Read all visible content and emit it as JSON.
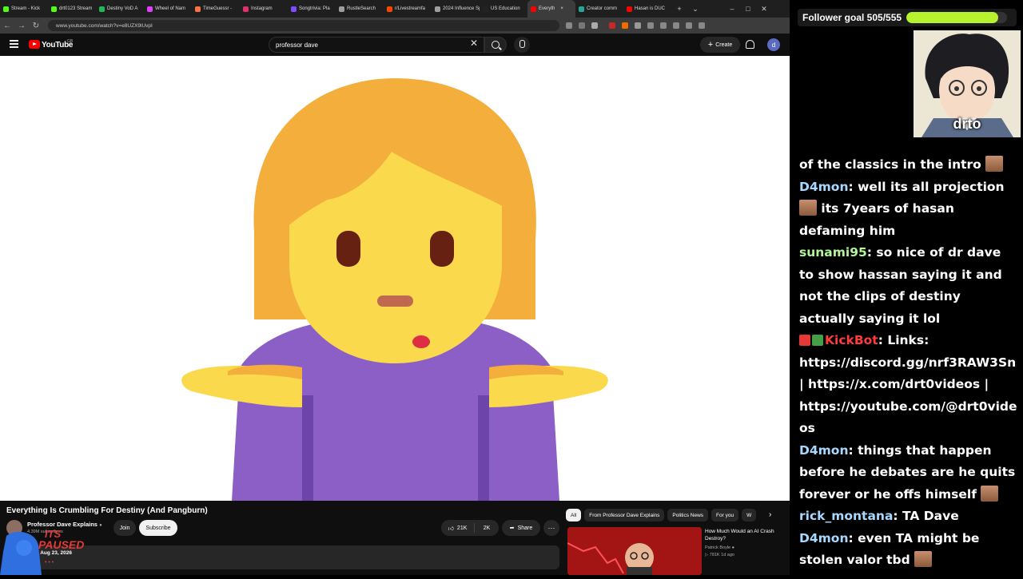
{
  "browser": {
    "tabs": [
      {
        "label": "Stream - Kick",
        "color": "#53fc18"
      },
      {
        "label": "drt0123 Stream",
        "color": "#53fc18"
      },
      {
        "label": "Destiny VoD A",
        "color": "#1db954"
      },
      {
        "label": "Wheel of Nam",
        "color": "#e040fb"
      },
      {
        "label": "TimeGuessr -",
        "color": "#ff7043"
      },
      {
        "label": "Instagram",
        "color": "#e1306c"
      },
      {
        "label": "Songtrivia: Pla",
        "color": "#7c4dff"
      },
      {
        "label": "RustleSearch",
        "color": "#9e9e9e"
      },
      {
        "label": "r/Livestreamfa",
        "color": "#ff4500"
      },
      {
        "label": "2024 Influence Sp",
        "color": "#9e9e9e"
      },
      {
        "label": "US Education",
        "color": "#222222"
      },
      {
        "label": "Everyth",
        "color": "#ff0000",
        "active": true
      },
      {
        "label": "Creator comm",
        "color": "#26a69a"
      },
      {
        "label": "Hasan is DUC",
        "color": "#ff0000"
      }
    ],
    "new_tab": "+",
    "tab_dropdown": "⌄",
    "window_controls": [
      "–",
      "□",
      "✕"
    ],
    "url": "www.youtube.com/watch?v=e8UZX9lUvpI",
    "nav": {
      "back": "←",
      "forward": "→",
      "reload": "↻"
    }
  },
  "youtube": {
    "logo_text": "YouTube",
    "country_code": "GB",
    "search_value": "professor dave",
    "search_clear": "✕",
    "create_label": "Create",
    "create_plus": "+",
    "avatar_letter": "d"
  },
  "video": {
    "title": "Everything Is Crumbling For Destiny (And Pangburn)",
    "channel": "Professor Dave Explains",
    "subscribers": "4.39M subscribers",
    "join_label": "Join",
    "subscribe_label": "Subscribe",
    "likes": "21K",
    "dislikes": "2K",
    "share_label": "Share",
    "more": "···",
    "description_meta": "ws  Aug 23, 2026"
  },
  "recommendations": {
    "chips": [
      "All",
      "From Professor Dave Explains",
      "Politics News",
      "For you",
      "W"
    ],
    "next": "›",
    "items": [
      {
        "title": "How Much Would an AI Crash Destroy?",
        "channel": "Patrick Boyle",
        "meta": "▷ 781K  1d ago"
      }
    ]
  },
  "overlay": {
    "paused_line1": "ITS",
    "paused_line2": "PAUSED",
    "paused_dots": "• • •"
  },
  "stream": {
    "goal_label": "Follower goal 505/555",
    "goal_fraction": 0.91,
    "goal_color": "#b6f22e",
    "cam_name": "drto"
  },
  "chat": [
    {
      "user": "",
      "color": "",
      "text": "of the classics in the intro ",
      "emote": true
    },
    {
      "user": "D4mon",
      "color": "#a8d8ff",
      "text": "well its all projection ",
      "emote": true,
      "text2": " its 7years of hasan defaming him"
    },
    {
      "user": "sunami95",
      "color": "#b2f59a",
      "text": "so nice of dr dave to show hassan saying it and not the clips of destiny actually saying it lol"
    },
    {
      "user": "KickBot",
      "color": "#ff3b3b",
      "badges": true,
      "text": "Links: https://discord.gg/nrf3RAW3Sn | https://x.com/drt0videos | https://youtube.com/@drt0videos"
    },
    {
      "user": "D4mon",
      "color": "#a8d8ff",
      "text": "things that happen before he debates are he quits forever or he offs himself ",
      "emote": true
    },
    {
      "user": "rick_montana",
      "color": "#a8d8ff",
      "text": "TA Dave"
    },
    {
      "user": "D4mon",
      "color": "#a8d8ff",
      "text": "even TA might be stolen valor tbd ",
      "emote": true
    }
  ]
}
